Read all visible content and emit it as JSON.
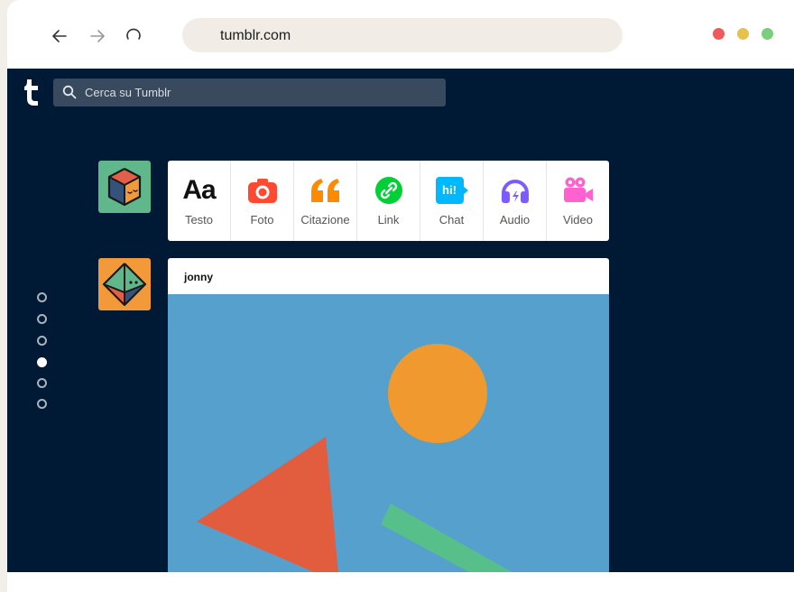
{
  "browser": {
    "url": "tumblr.com",
    "back_icon": "arrow-left-icon",
    "forward_icon": "arrow-right-icon",
    "reload_icon": "reload-icon",
    "window_dots": [
      "#ef5b5b",
      "#e6c24d",
      "#7ccd7c"
    ]
  },
  "tumblr": {
    "logo_text": "t",
    "search_placeholder": "Cerca su Tumblr",
    "post_types": [
      {
        "label": "Testo",
        "icon": "text-icon",
        "glyph": "Aa",
        "color": "#111111"
      },
      {
        "label": "Foto",
        "icon": "camera-icon",
        "color": "#ff4930"
      },
      {
        "label": "Citazione",
        "icon": "quote-icon",
        "color": "#ff8a00"
      },
      {
        "label": "Link",
        "icon": "link-icon",
        "color": "#00cf35"
      },
      {
        "label": "Chat",
        "icon": "chat-icon",
        "glyph": "hi!",
        "color": "#00b8ff"
      },
      {
        "label": "Audio",
        "icon": "headphones-icon",
        "color": "#7c5cff"
      },
      {
        "label": "Video",
        "icon": "video-camera-icon",
        "color": "#ff62ce"
      }
    ],
    "post": {
      "username": "jonny"
    },
    "slider": {
      "count": 6,
      "active_index": 3
    }
  }
}
